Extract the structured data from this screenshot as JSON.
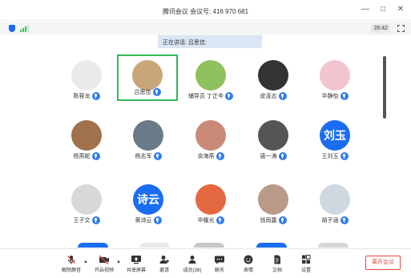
{
  "window": {
    "title": "腾讯会议 会议号: 416 970 681",
    "controls": [
      "—",
      "□",
      "✕"
    ]
  },
  "status": {
    "timer": "26:42"
  },
  "banner": {
    "text": "正在讲话: 吕思佳;"
  },
  "participants": [
    {
      "name": "陈蓉龙",
      "avatar_text": "",
      "color": "#eaeaea"
    },
    {
      "name": "吕思佳",
      "avatar_text": "",
      "color": "#c9a57a",
      "active": true
    },
    {
      "name": "辅导员 丁芷岑",
      "avatar_text": "",
      "color": "#8fc15e"
    },
    {
      "name": "皮凌志",
      "avatar_text": "",
      "color": "#333333"
    },
    {
      "name": "华静怡",
      "avatar_text": "",
      "color": "#f1c4d0"
    },
    {
      "name": "杨燕妮",
      "avatar_text": "",
      "color": "#a0714a"
    },
    {
      "name": "杨志军",
      "avatar_text": "",
      "color": "#6a7a88"
    },
    {
      "name": "余海燕",
      "avatar_text": "",
      "color": "#c98a78"
    },
    {
      "name": "唐一涛",
      "avatar_text": "",
      "color": "#555555"
    },
    {
      "name": "王刘玉",
      "avatar_text": "刘玉",
      "color": "#1a6df0"
    },
    {
      "name": "王子文",
      "avatar_text": "",
      "color": "#d8d8d8"
    },
    {
      "name": "黄诗云",
      "avatar_text": "诗云",
      "color": "#1a6df0"
    },
    {
      "name": "华耀光",
      "avatar_text": "",
      "color": "#e4683f"
    },
    {
      "name": "钱雨露",
      "avatar_text": "",
      "color": "#b89a86"
    },
    {
      "name": "胡子涵",
      "avatar_text": "",
      "color": "#cfd7e0"
    }
  ],
  "toolbar": {
    "unmute": "解除静音",
    "video": "开启视频",
    "share": "共享屏幕",
    "invite": "邀请",
    "members": "成员(38)",
    "chat": "聊天",
    "reactions": "表情",
    "docs": "文档",
    "settings": "设置",
    "leave": "离开会议"
  },
  "colors": {
    "accent": "#1a6df0",
    "active_border": "#34b85a",
    "leave": "#e34a3f"
  }
}
